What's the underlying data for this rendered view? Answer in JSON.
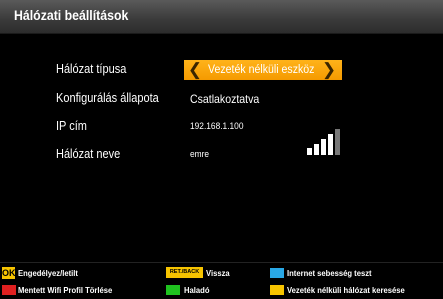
{
  "header": {
    "title": "Hálózati beállítások"
  },
  "settings": {
    "network_type": {
      "label": "Hálózat típusa",
      "value": "Vezeték nélküli eszköz"
    },
    "config_status": {
      "label": "Konfigurálás állapota",
      "value": "Csatlakoztatva"
    },
    "ip_address": {
      "label": "IP cím",
      "value": "192.168.1.100"
    },
    "network_name": {
      "label": "Hálózat neve",
      "value": "emre"
    }
  },
  "signal": {
    "icon": "wifi-signal-strength-icon",
    "level": 0.8
  },
  "footer": {
    "ok": {
      "key": "OK",
      "label": "Engedélyez/letilt"
    },
    "back": {
      "key": "RET./BACK",
      "label": "Vissza"
    },
    "blue": {
      "label": "Internet sebesség teszt",
      "color": "#29a8e6"
    },
    "red": {
      "label": "Mentett Wifi Profil Törlése",
      "color": "#e02020"
    },
    "green": {
      "label": "Haladó",
      "color": "#1fc21f"
    },
    "yellow": {
      "label": "Vezeték nélküli hálózat keresése",
      "color": "#f7c400"
    }
  },
  "colors": {
    "accent": "#f5a000",
    "header_bg": "#3a3a3a"
  }
}
